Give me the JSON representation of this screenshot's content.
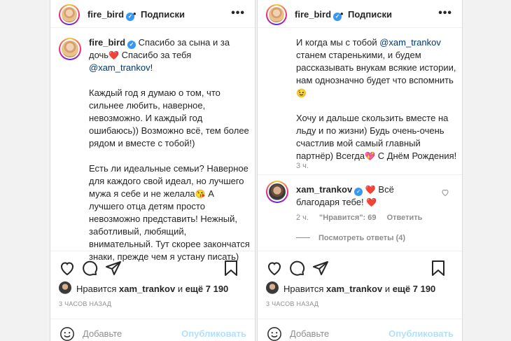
{
  "left": {
    "header": {
      "username": "fire_bird",
      "dot": "•",
      "follow": "Подписки",
      "more": "•••"
    },
    "caption": {
      "username": "fire_bird",
      "p1_a": "Спасибо за сына и за дочь",
      "p1_emoji": "❤️",
      "p1_b": " Спасибо за тебя ",
      "p1_mention": "@xam_trankov",
      "p1_end": "!",
      "p2": "Каждый год я думаю о том, что сильнее любить, наверное, невозможно. И каждый год ошибаюсь)) Возможно всё, тем более рядом и вместе с тобой!)",
      "p3_a": "Есть ли идеальные семьи? Наверное для каждого свой идеал, но лучшего мужа я себе и не желала",
      "p3_emoji": "😘",
      "p3_b": " А лучшего отца детям просто невозможно представить! Нежный, заботливый, любящий, внимательный. Тут скорее закончатся знаки, прежде чем я устану писать)"
    },
    "likes": {
      "prefix": "Нравится ",
      "user": "xam_trankov",
      "mid": " и ",
      "count": "ещё 7 190"
    },
    "timestamp": "3 ЧАСОВ НАЗАД",
    "comment": {
      "placeholder": "Добавьте",
      "publish": "Опубликовать"
    }
  },
  "right": {
    "header": {
      "username": "fire_bird",
      "dot": "•",
      "follow": "Подписки",
      "more": "•••"
    },
    "caption": {
      "p1_a": "И когда мы с тобой ",
      "p1_mention": "@xam_trankov",
      "p1_b": " станем старенькими, и будем рассказывать внукам всякие истории, нам однозначно будет что вспомнить",
      "p1_emoji": "😉",
      "p2_a": "Хочу и дальше скользить вместе на льду и по жизни) Будь очень-очень счастлив мой самый главный партнёр) Всегда",
      "p2_emoji": "💖",
      "p2_b": " С Днём Рождения!"
    },
    "caption_time": "3 ч.",
    "reply": {
      "username": "xam_trankov",
      "emoji1": "❤️",
      "text": " Всё благодаря тебе! ",
      "emoji2": "❤️",
      "time": "2 ч.",
      "likes": "\"Нравится\": 69",
      "answer": "Ответить",
      "view_replies": "Посмотреть ответы (4)"
    },
    "likes": {
      "prefix": "Нравится ",
      "user": "xam_trankov",
      "mid": " и ",
      "count": "ещё 7 190"
    },
    "timestamp": "3 ЧАСОВ НАЗАД",
    "comment": {
      "placeholder": "Добавьте",
      "publish": "Опубликовать"
    }
  }
}
